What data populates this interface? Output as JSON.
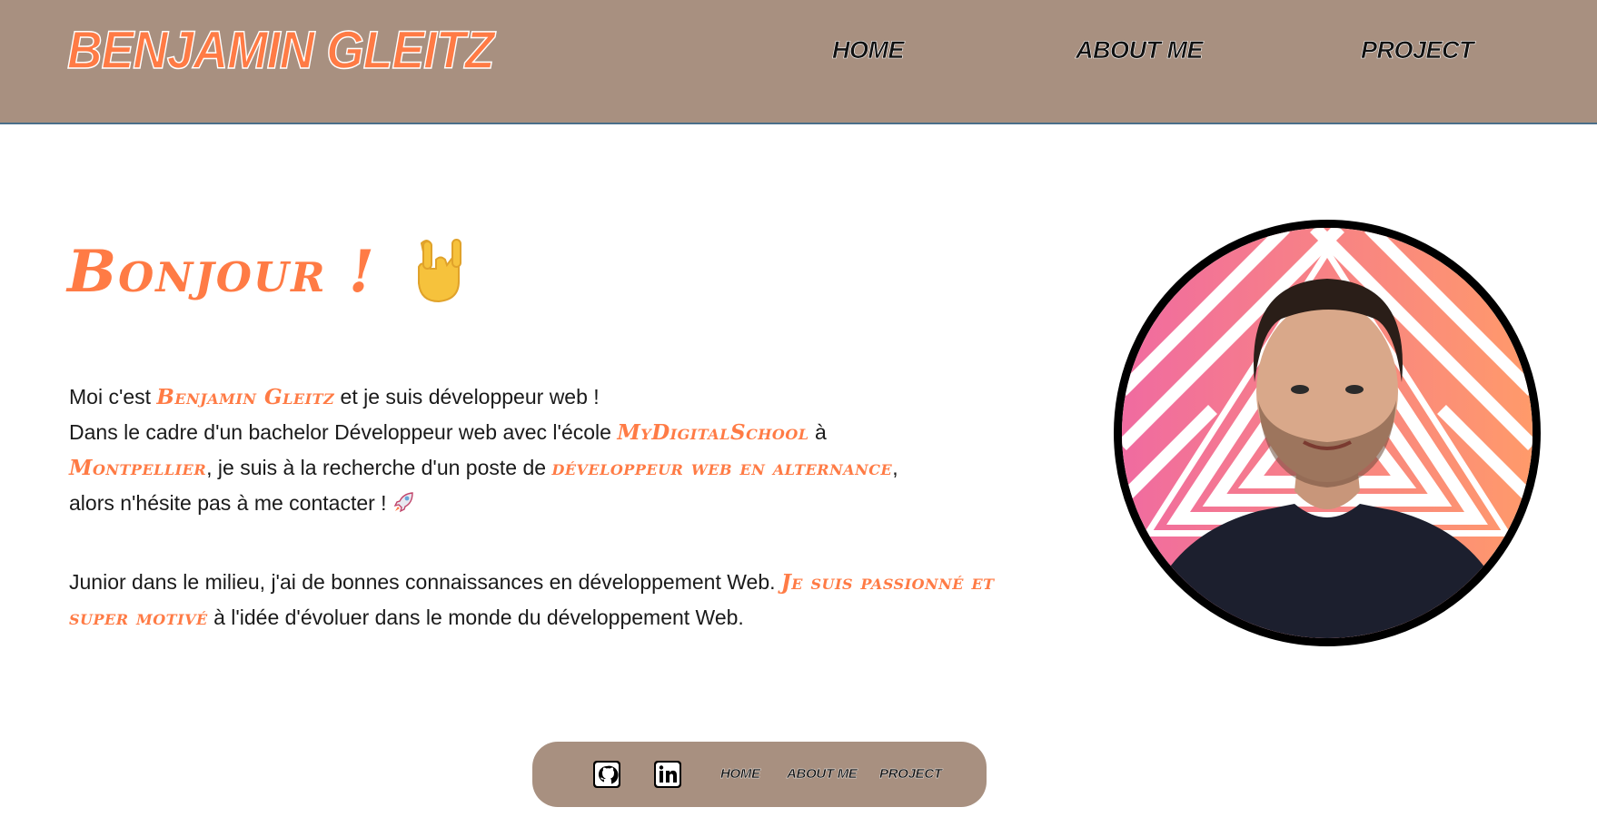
{
  "header": {
    "brand": "Benjamin Gleitz",
    "nav": [
      {
        "label": "Home"
      },
      {
        "label": "About me"
      },
      {
        "label": "Project"
      }
    ]
  },
  "hero": {
    "title": "Bonjour !",
    "title_emoji_icon": "rock-hand-icon",
    "p1": {
      "a": "Moi c'est ",
      "name": "Benjamin Gleitz",
      "b": " et je suis développeur web !",
      "c": "Dans le cadre d'un bachelor Développeur web avec l'école ",
      "school": "MyDigitalSchool",
      "d": " à",
      "city": "Montpellier",
      "e": ", je suis à la recherche d'un poste de ",
      "role": "développeur web en alternance",
      "f": ",",
      "g": "alors n'hésite pas à me contacter ! ",
      "emoji_icon": "rocket-icon"
    },
    "p2": {
      "a": "Junior dans le milieu, j'ai de bonnes connaissances en développement Web. ",
      "hl": "Je suis passionné et super motivé",
      "b": " à l'idée d'évoluer dans le monde du développement Web."
    }
  },
  "footer": {
    "icons": [
      "github-icon",
      "linkedin-icon"
    ],
    "links": [
      {
        "label": "Home"
      },
      {
        "label": "About me"
      },
      {
        "label": "Project"
      }
    ]
  },
  "colors": {
    "accent": "#ff7b45",
    "header_bg": "#a89080",
    "text": "#1a1a1a"
  }
}
